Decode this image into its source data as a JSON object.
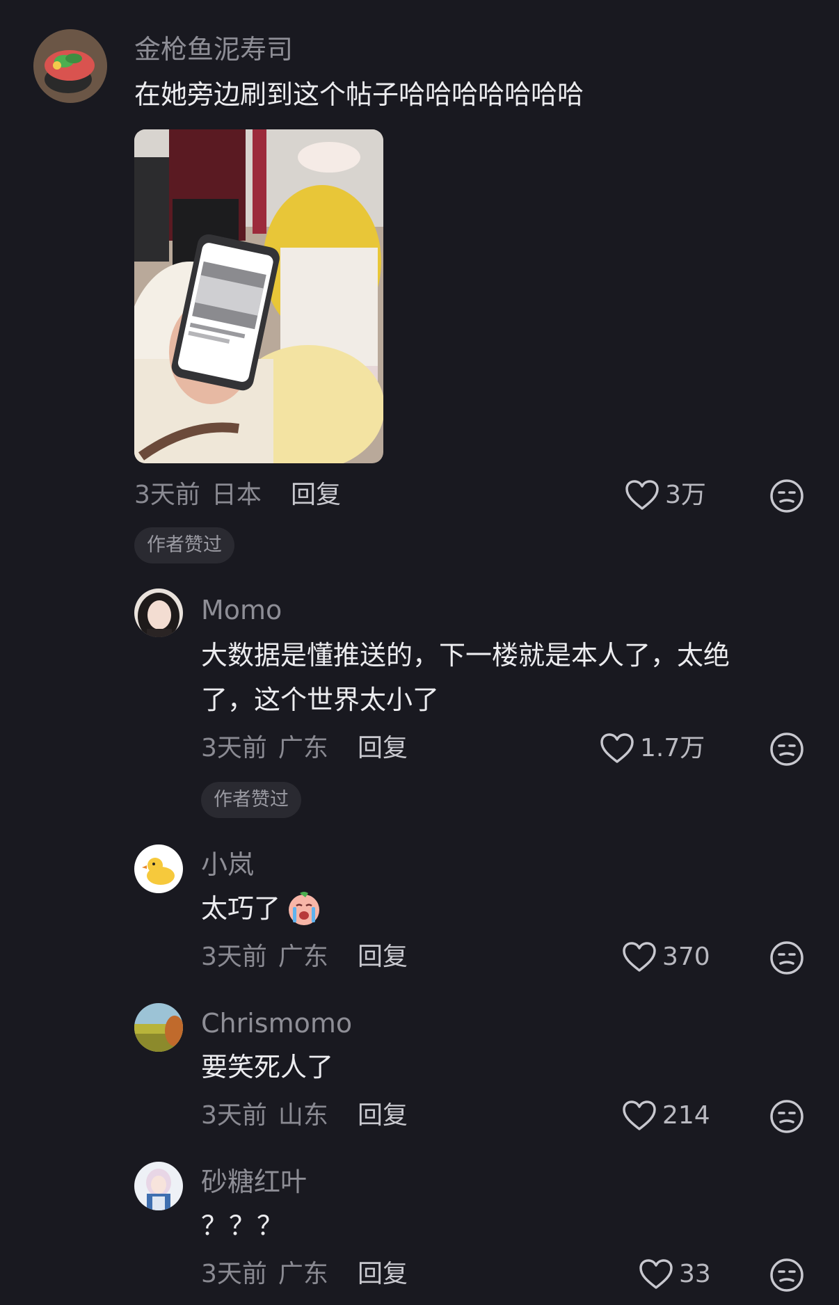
{
  "comments": [
    {
      "username": "金枪鱼泥寿司",
      "text": "在她旁边刷到这个帖子哈哈哈哈哈哈哈",
      "time": "3天前",
      "location": "日本",
      "reply_label": "回复",
      "likes": "3万",
      "badge": "作者赞过",
      "avatar_icon": "sushi-avatar"
    },
    {
      "username": "Momo",
      "text_line1": "大数据是懂推送的，下一楼就是本人了，太绝",
      "text_line2": "了，这个世界太小了",
      "time": "3天前",
      "location": "广东",
      "reply_label": "回复",
      "likes": "1.7万",
      "badge": "作者赞过",
      "avatar_icon": "girl-portrait-avatar"
    },
    {
      "username": "小岚",
      "text": "太巧了",
      "emoji": "crying-face-emoji",
      "time": "3天前",
      "location": "广东",
      "reply_label": "回复",
      "likes": "370",
      "avatar_icon": "duck-avatar"
    },
    {
      "username": "Chrismomo",
      "text": "要笑死人了",
      "time": "3天前",
      "location": "山东",
      "reply_label": "回复",
      "likes": "214",
      "avatar_icon": "landscape-avatar"
    },
    {
      "username": "砂糖红叶",
      "text": "？？？",
      "time": "3天前",
      "location": "广东",
      "reply_label": "回复",
      "likes": "33",
      "avatar_icon": "anime-character-avatar"
    }
  ],
  "colors": {
    "background": "#191920",
    "username": "#8e8e96",
    "content": "#ececef",
    "meta": "#8a8a92",
    "badge_bg": "#2a2a31"
  }
}
